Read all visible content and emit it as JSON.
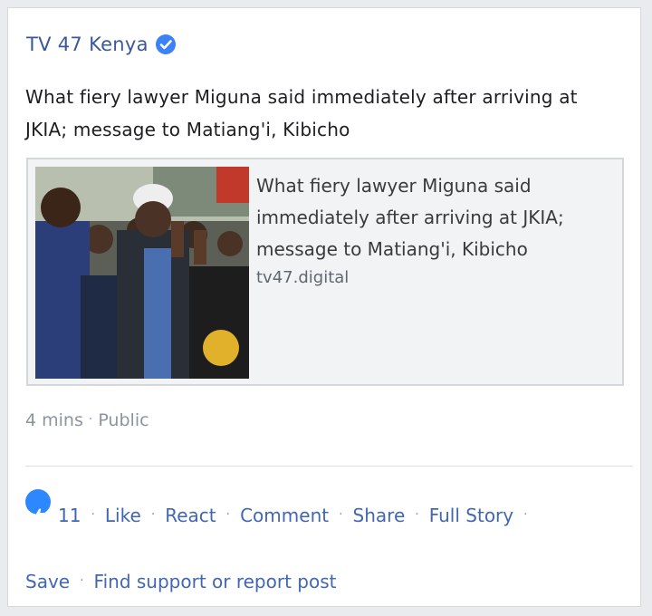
{
  "post": {
    "page_name": "TV 47 Kenya",
    "verified_icon": "verified-check-icon",
    "text": "What fiery lawyer Miguna said immediately after arriving at JKIA; message to Matiang'i, Kibicho"
  },
  "link_preview": {
    "title": "What fiery lawyer Miguna said immediately after arriving at JKIA; message to Matiang'i, Kibicho",
    "domain": "tv47.digital"
  },
  "meta": {
    "time": "4 mins",
    "separator": "·",
    "audience": "Public"
  },
  "actions": {
    "like_icon": "thumbs-up-icon",
    "like_count": "11",
    "separator": "·",
    "like": "Like",
    "react": "React",
    "comment": "Comment",
    "share": "Share",
    "full_story": "Full Story",
    "save": "Save",
    "report": "Find support or report post"
  },
  "colors": {
    "accent": "#3b5998",
    "link_blue": "#4267b2",
    "like_blue": "#2d88ff",
    "muted": "#8d949e"
  }
}
